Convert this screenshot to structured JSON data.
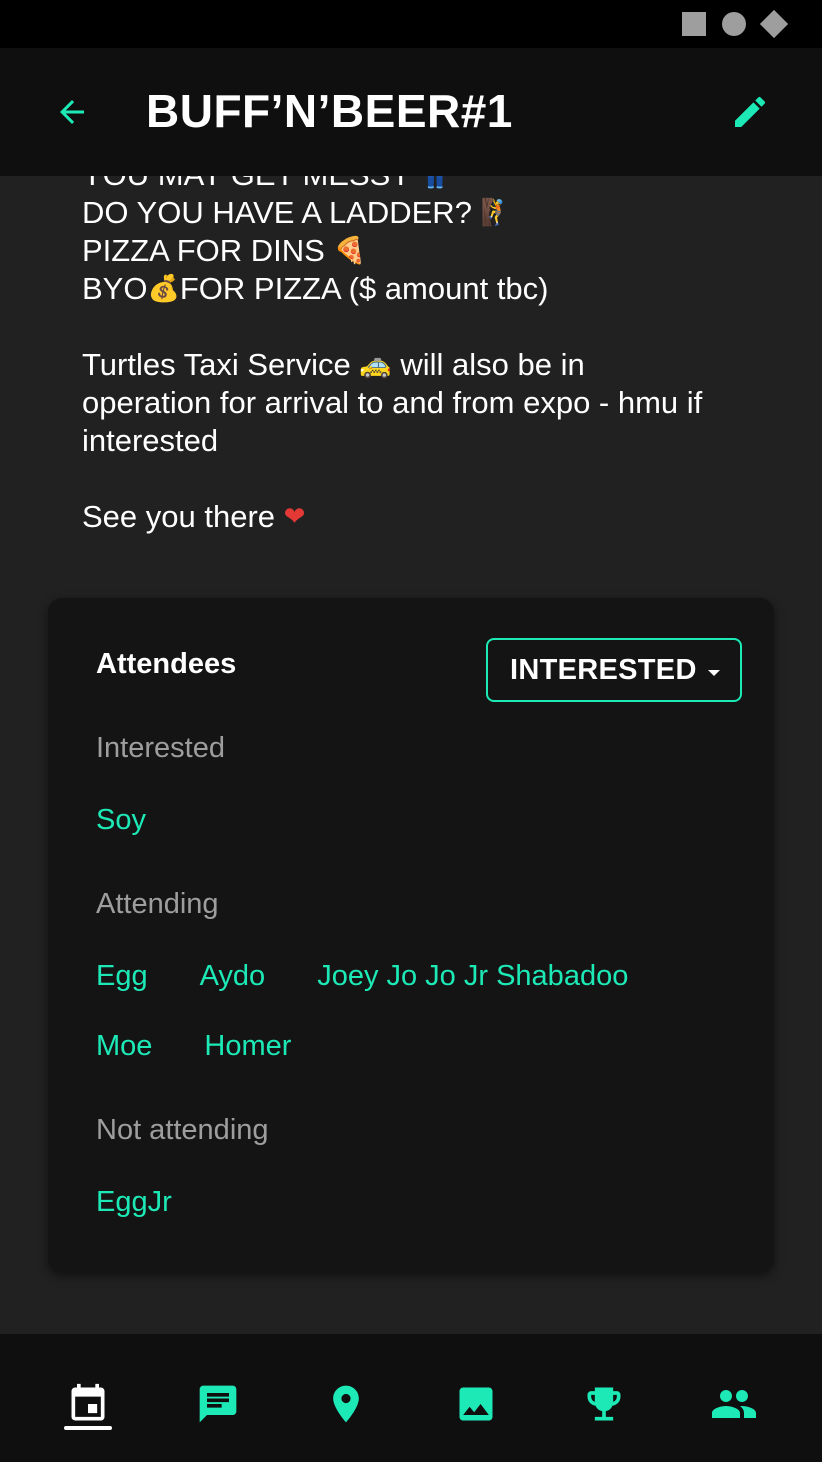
{
  "status_bar": {
    "icons": [
      "square-icon",
      "circle-icon",
      "diamond-icon"
    ]
  },
  "header": {
    "title": "BUFF’N’BEER#1",
    "back_icon": "arrow-back-icon",
    "edit_icon": "pencil-icon"
  },
  "description": {
    "lines": {
      "l1": "YOU MAY GET MESSY",
      "l2": "DO YOU HAVE A LADDER?",
      "l3": "PIZZA FOR DINS",
      "l4a": "BYO",
      "l4b": "FOR PIZZA ($ amount tbc)",
      "l5": "Turtles Taxi Service",
      "l5b": "will also be in",
      "l6": "operation for arrival to and from expo - hmu if",
      "l7": "interested",
      "l8": "See you there"
    },
    "emojis": {
      "messy": "👖",
      "ladder": "🧗",
      "pizza": "🍕",
      "money": "💰",
      "taxi": "🚕",
      "heart": "❤"
    }
  },
  "attendees": {
    "title": "Attendees",
    "filter_value": "INTERESTED",
    "interested_label": "Interested",
    "interested": [
      "Soy"
    ],
    "attending_label": "Attending",
    "attending": [
      "Egg",
      "Aydo",
      "Joey Jo Jo Jr Shabadoo",
      "Moe",
      "Homer"
    ],
    "not_attending_label": "Not attending",
    "not_attending": [
      "EggJr"
    ]
  },
  "bottom_nav": {
    "items": [
      "calendar-icon",
      "chat-icon",
      "location-pin-icon",
      "image-icon",
      "trophy-icon",
      "people-icon"
    ],
    "active": "calendar-icon"
  },
  "colors": {
    "accent": "#1de9b6",
    "background": "#212121",
    "card": "#141414",
    "bar": "#0f0f0f"
  }
}
